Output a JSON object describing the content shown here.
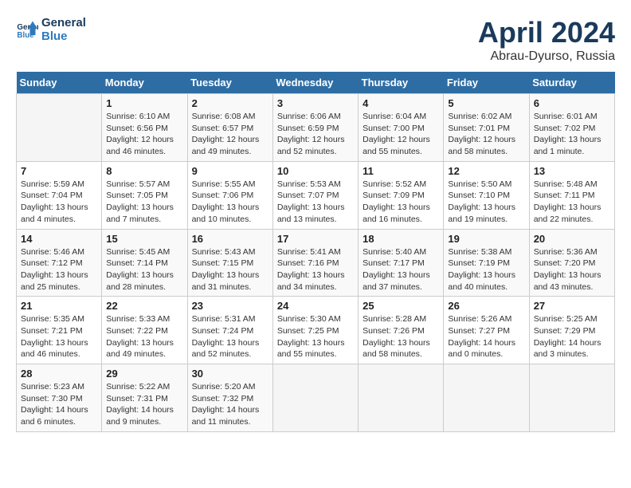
{
  "header": {
    "logo_line1": "General",
    "logo_line2": "Blue",
    "title": "April 2024",
    "subtitle": "Abrau-Dyurso, Russia"
  },
  "calendar": {
    "days_of_week": [
      "Sunday",
      "Monday",
      "Tuesday",
      "Wednesday",
      "Thursday",
      "Friday",
      "Saturday"
    ],
    "weeks": [
      [
        {
          "day": "",
          "info": ""
        },
        {
          "day": "1",
          "info": "Sunrise: 6:10 AM\nSunset: 6:56 PM\nDaylight: 12 hours\nand 46 minutes."
        },
        {
          "day": "2",
          "info": "Sunrise: 6:08 AM\nSunset: 6:57 PM\nDaylight: 12 hours\nand 49 minutes."
        },
        {
          "day": "3",
          "info": "Sunrise: 6:06 AM\nSunset: 6:59 PM\nDaylight: 12 hours\nand 52 minutes."
        },
        {
          "day": "4",
          "info": "Sunrise: 6:04 AM\nSunset: 7:00 PM\nDaylight: 12 hours\nand 55 minutes."
        },
        {
          "day": "5",
          "info": "Sunrise: 6:02 AM\nSunset: 7:01 PM\nDaylight: 12 hours\nand 58 minutes."
        },
        {
          "day": "6",
          "info": "Sunrise: 6:01 AM\nSunset: 7:02 PM\nDaylight: 13 hours\nand 1 minute."
        }
      ],
      [
        {
          "day": "7",
          "info": "Sunrise: 5:59 AM\nSunset: 7:04 PM\nDaylight: 13 hours\nand 4 minutes."
        },
        {
          "day": "8",
          "info": "Sunrise: 5:57 AM\nSunset: 7:05 PM\nDaylight: 13 hours\nand 7 minutes."
        },
        {
          "day": "9",
          "info": "Sunrise: 5:55 AM\nSunset: 7:06 PM\nDaylight: 13 hours\nand 10 minutes."
        },
        {
          "day": "10",
          "info": "Sunrise: 5:53 AM\nSunset: 7:07 PM\nDaylight: 13 hours\nand 13 minutes."
        },
        {
          "day": "11",
          "info": "Sunrise: 5:52 AM\nSunset: 7:09 PM\nDaylight: 13 hours\nand 16 minutes."
        },
        {
          "day": "12",
          "info": "Sunrise: 5:50 AM\nSunset: 7:10 PM\nDaylight: 13 hours\nand 19 minutes."
        },
        {
          "day": "13",
          "info": "Sunrise: 5:48 AM\nSunset: 7:11 PM\nDaylight: 13 hours\nand 22 minutes."
        }
      ],
      [
        {
          "day": "14",
          "info": "Sunrise: 5:46 AM\nSunset: 7:12 PM\nDaylight: 13 hours\nand 25 minutes."
        },
        {
          "day": "15",
          "info": "Sunrise: 5:45 AM\nSunset: 7:14 PM\nDaylight: 13 hours\nand 28 minutes."
        },
        {
          "day": "16",
          "info": "Sunrise: 5:43 AM\nSunset: 7:15 PM\nDaylight: 13 hours\nand 31 minutes."
        },
        {
          "day": "17",
          "info": "Sunrise: 5:41 AM\nSunset: 7:16 PM\nDaylight: 13 hours\nand 34 minutes."
        },
        {
          "day": "18",
          "info": "Sunrise: 5:40 AM\nSunset: 7:17 PM\nDaylight: 13 hours\nand 37 minutes."
        },
        {
          "day": "19",
          "info": "Sunrise: 5:38 AM\nSunset: 7:19 PM\nDaylight: 13 hours\nand 40 minutes."
        },
        {
          "day": "20",
          "info": "Sunrise: 5:36 AM\nSunset: 7:20 PM\nDaylight: 13 hours\nand 43 minutes."
        }
      ],
      [
        {
          "day": "21",
          "info": "Sunrise: 5:35 AM\nSunset: 7:21 PM\nDaylight: 13 hours\nand 46 minutes."
        },
        {
          "day": "22",
          "info": "Sunrise: 5:33 AM\nSunset: 7:22 PM\nDaylight: 13 hours\nand 49 minutes."
        },
        {
          "day": "23",
          "info": "Sunrise: 5:31 AM\nSunset: 7:24 PM\nDaylight: 13 hours\nand 52 minutes."
        },
        {
          "day": "24",
          "info": "Sunrise: 5:30 AM\nSunset: 7:25 PM\nDaylight: 13 hours\nand 55 minutes."
        },
        {
          "day": "25",
          "info": "Sunrise: 5:28 AM\nSunset: 7:26 PM\nDaylight: 13 hours\nand 58 minutes."
        },
        {
          "day": "26",
          "info": "Sunrise: 5:26 AM\nSunset: 7:27 PM\nDaylight: 14 hours\nand 0 minutes."
        },
        {
          "day": "27",
          "info": "Sunrise: 5:25 AM\nSunset: 7:29 PM\nDaylight: 14 hours\nand 3 minutes."
        }
      ],
      [
        {
          "day": "28",
          "info": "Sunrise: 5:23 AM\nSunset: 7:30 PM\nDaylight: 14 hours\nand 6 minutes."
        },
        {
          "day": "29",
          "info": "Sunrise: 5:22 AM\nSunset: 7:31 PM\nDaylight: 14 hours\nand 9 minutes."
        },
        {
          "day": "30",
          "info": "Sunrise: 5:20 AM\nSunset: 7:32 PM\nDaylight: 14 hours\nand 11 minutes."
        },
        {
          "day": "",
          "info": ""
        },
        {
          "day": "",
          "info": ""
        },
        {
          "day": "",
          "info": ""
        },
        {
          "day": "",
          "info": ""
        }
      ]
    ]
  }
}
